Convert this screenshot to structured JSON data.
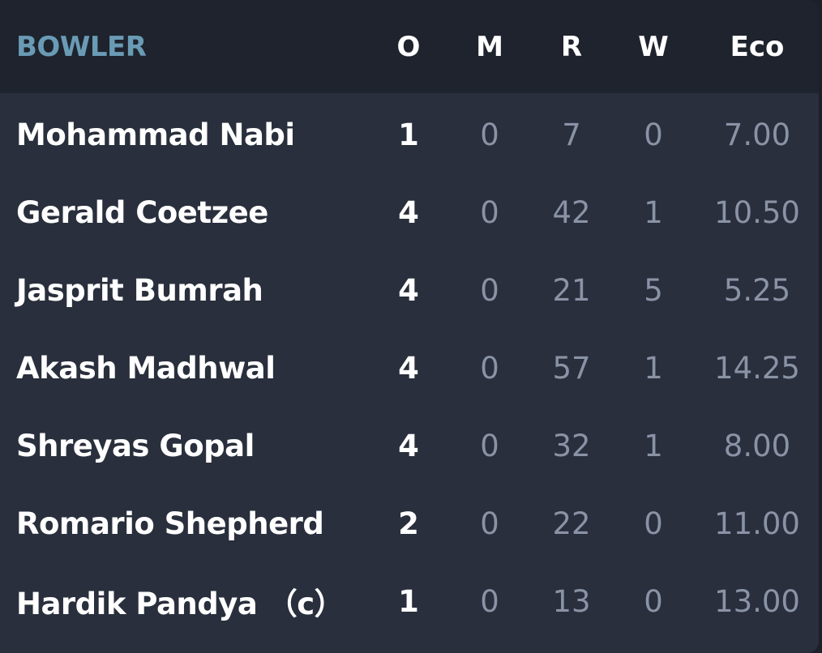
{
  "table": {
    "columns": {
      "bowler": "BOWLER",
      "overs": "O",
      "maidens": "M",
      "runs": "R",
      "wickets": "W",
      "economy": "Eco"
    },
    "rows": [
      {
        "name": "Mohammad Nabi",
        "overs": "1",
        "maidens": "0",
        "runs": "7",
        "wickets": "0",
        "economy": "7.00"
      },
      {
        "name": "Gerald Coetzee",
        "overs": "4",
        "maidens": "0",
        "runs": "42",
        "wickets": "1",
        "economy": "10.50"
      },
      {
        "name": "Jasprit Bumrah",
        "overs": "4",
        "maidens": "0",
        "runs": "21",
        "wickets": "5",
        "economy": "5.25"
      },
      {
        "name": "Akash Madhwal",
        "overs": "4",
        "maidens": "0",
        "runs": "57",
        "wickets": "1",
        "economy": "14.25"
      },
      {
        "name": "Shreyas Gopal",
        "overs": "4",
        "maidens": "0",
        "runs": "32",
        "wickets": "1",
        "economy": "8.00"
      },
      {
        "name": "Romario Shepherd",
        "overs": "2",
        "maidens": "0",
        "runs": "22",
        "wickets": "0",
        "economy": "11.00"
      },
      {
        "name": "Hardik Pandya （c）",
        "overs": "1",
        "maidens": "0",
        "runs": "13",
        "wickets": "0",
        "economy": "13.00"
      }
    ]
  },
  "colors": {
    "header_background": "#1e232d",
    "card_background": "#292f3c",
    "header_title": "#6a9bb5",
    "primary_text": "#ffffff",
    "muted_text": "#8a93a6"
  }
}
